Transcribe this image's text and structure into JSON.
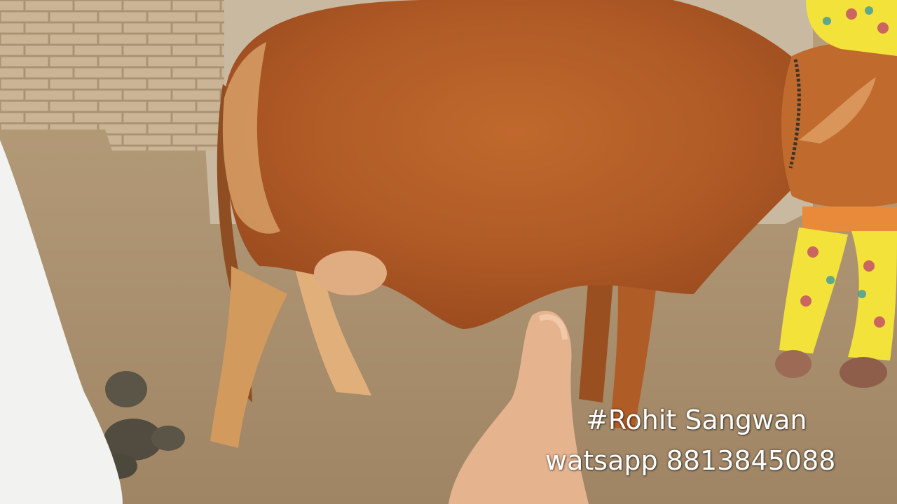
{
  "overlay": {
    "name": "#Rohit Sangwan",
    "contact": "watsapp 8813845088"
  },
  "colors": {
    "ground": "#a98f6e",
    "wall": "#c9b9a0",
    "brick": "#cbb496",
    "cow_coat": "#b8622a",
    "cow_light": "#d9a46a",
    "skin": "#e6b38f",
    "garment_yellow": "#f2e23a",
    "caption": "#ffffff"
  }
}
